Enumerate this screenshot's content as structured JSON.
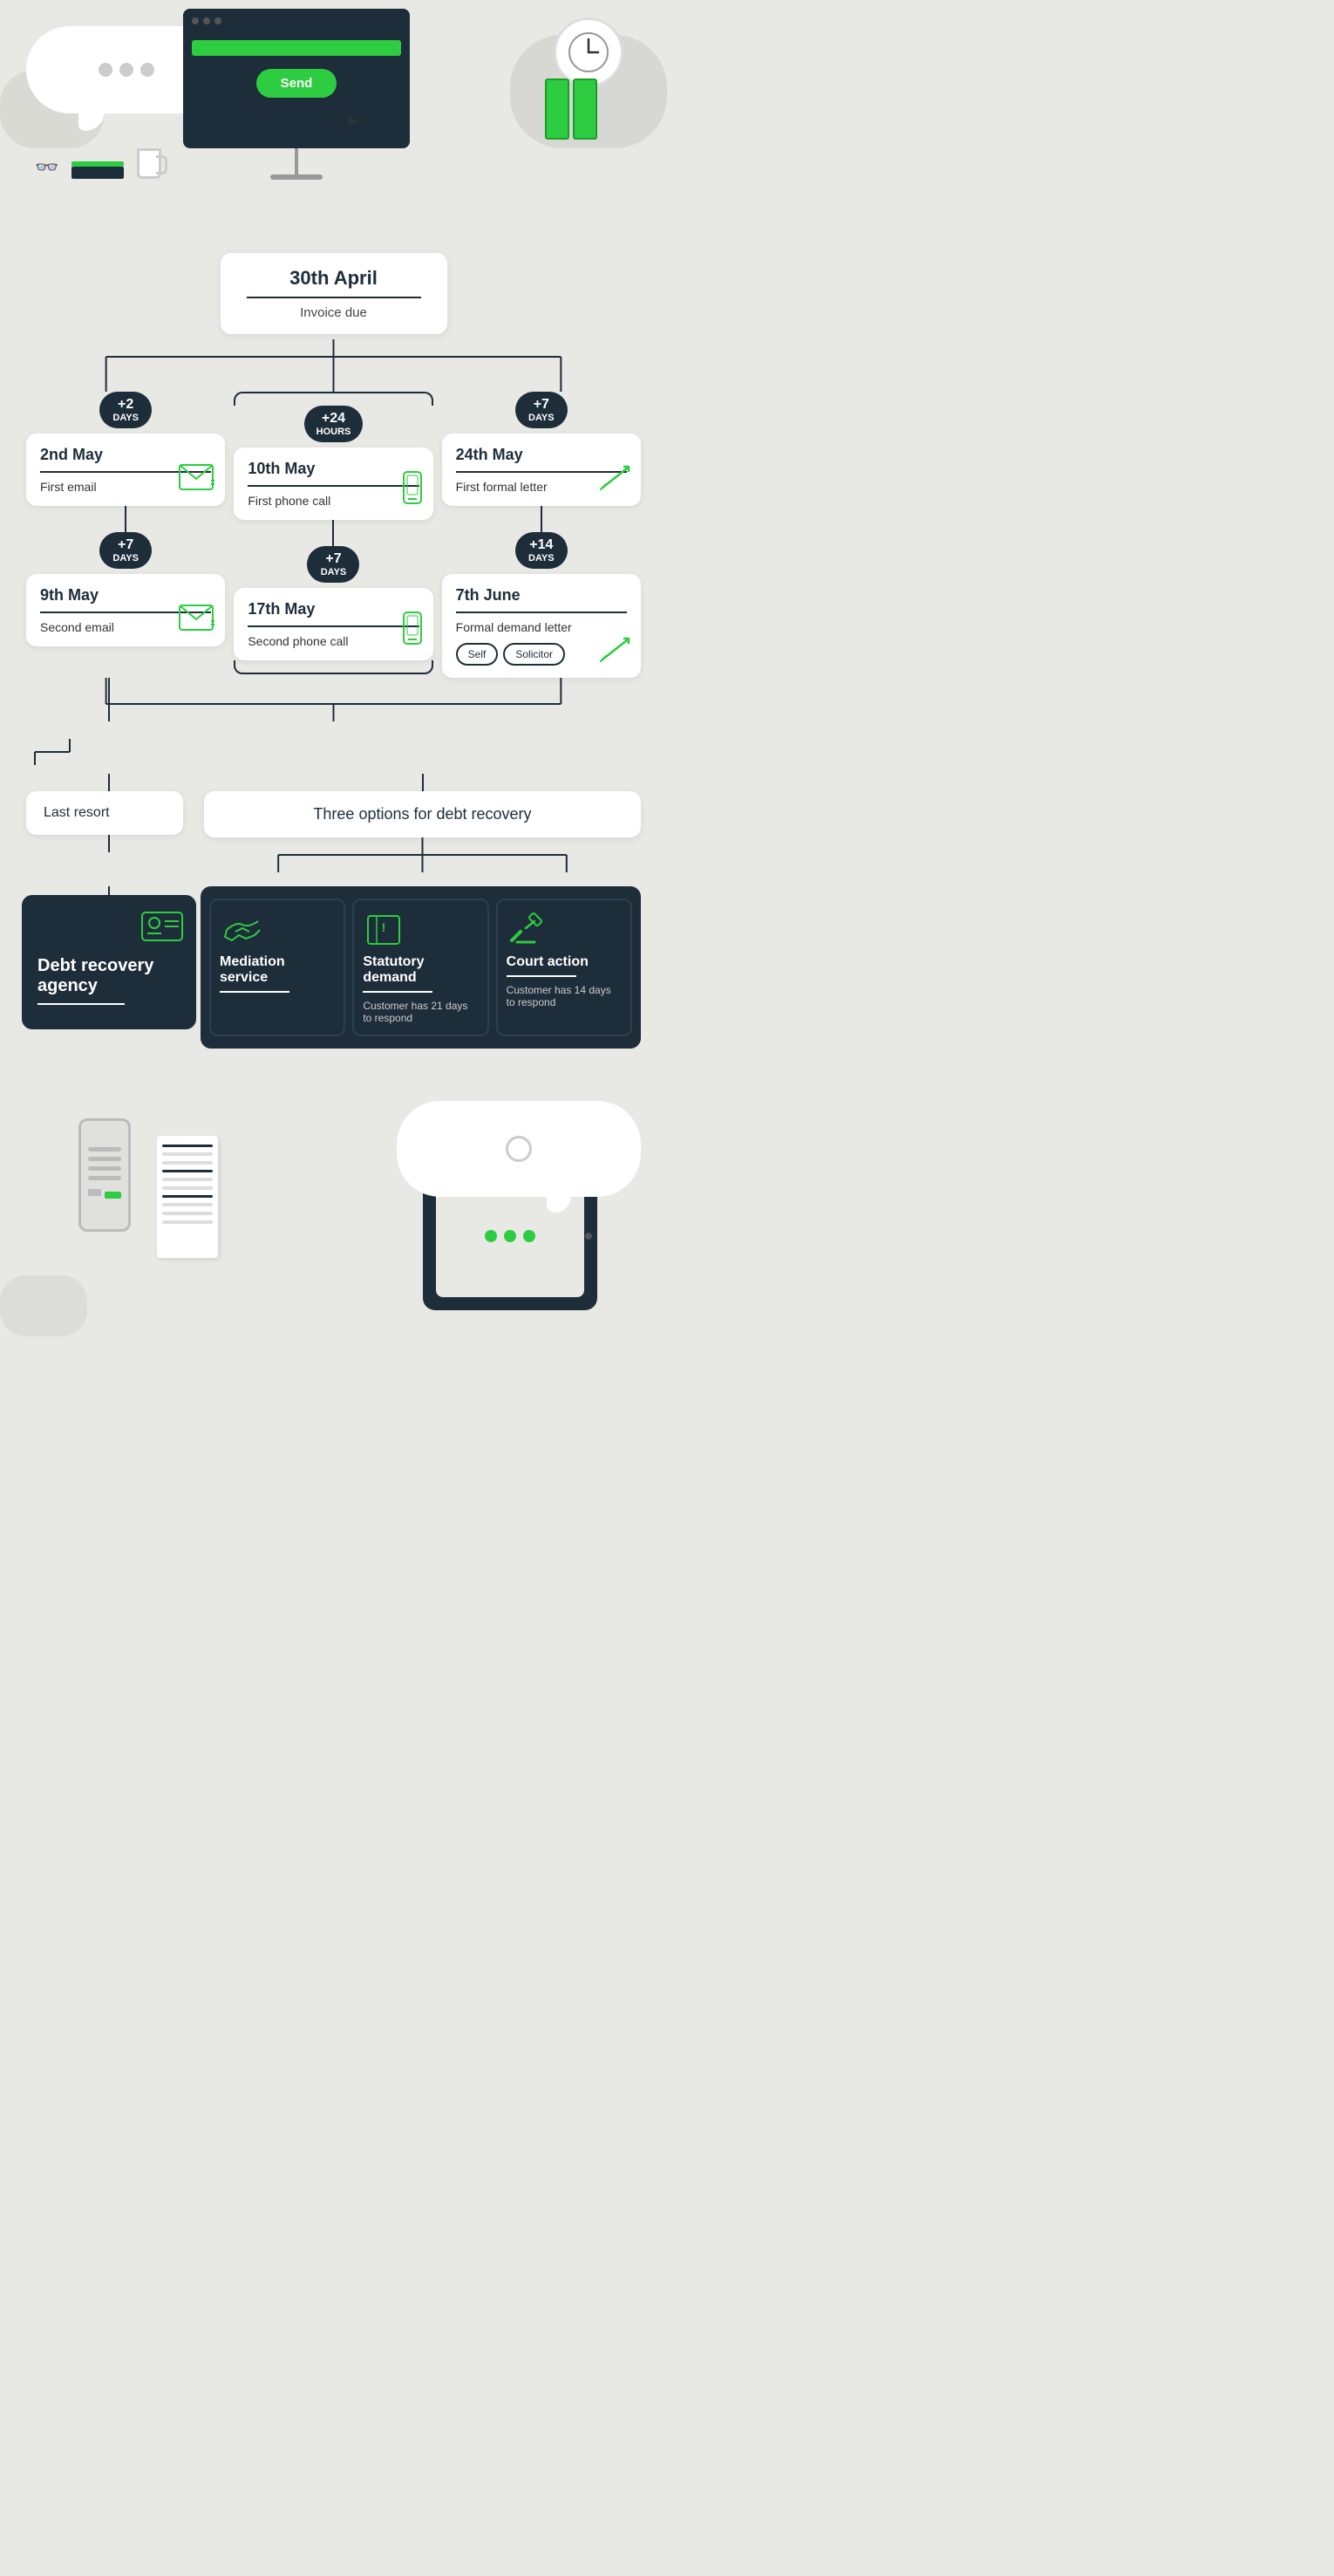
{
  "topIllustration": {
    "sendButton": "Send",
    "dots": [
      "",
      "",
      ""
    ],
    "greenDots": [
      "",
      "",
      ""
    ]
  },
  "invoiceBox": {
    "date": "30th April",
    "label": "Invoice due"
  },
  "timeline": {
    "col1": {
      "badge1": {
        "num": "+2",
        "unit": "DAYS"
      },
      "step1": {
        "date": "2nd May",
        "label": "First email"
      },
      "badge2": {
        "num": "+7",
        "unit": "DAYS"
      },
      "step2": {
        "date": "9th May",
        "label": "Second email"
      }
    },
    "col2": {
      "badge1": {
        "num": "+24",
        "unit": "HOURS"
      },
      "step1": {
        "date": "10th May",
        "label": "First phone call"
      },
      "badge2": {
        "num": "+7",
        "unit": "DAYS"
      },
      "step2": {
        "date": "17th May",
        "label": "Second phone call"
      }
    },
    "col3": {
      "badge1": {
        "num": "+7",
        "unit": "DAYS"
      },
      "step1": {
        "date": "24th May",
        "label": "First formal letter"
      },
      "badge2": {
        "num": "+14",
        "unit": "DAYS"
      },
      "step2": {
        "date": "7th June",
        "label": "Formal demand letter",
        "btn1": "Self",
        "btn2": "Solicitor"
      }
    }
  },
  "lastResort": {
    "label": "Last resort"
  },
  "threeOptions": {
    "label": "Three options for debt recovery"
  },
  "recoveryOptions": {
    "debtAgency": {
      "title": "Debt recovery agency"
    },
    "mediation": {
      "title": "Mediation service"
    },
    "statutory": {
      "title": "Statutory demand",
      "desc": "Customer has 21 days to respond"
    },
    "court": {
      "title": "Court action",
      "desc": "Customer has 14 days to respond"
    }
  }
}
